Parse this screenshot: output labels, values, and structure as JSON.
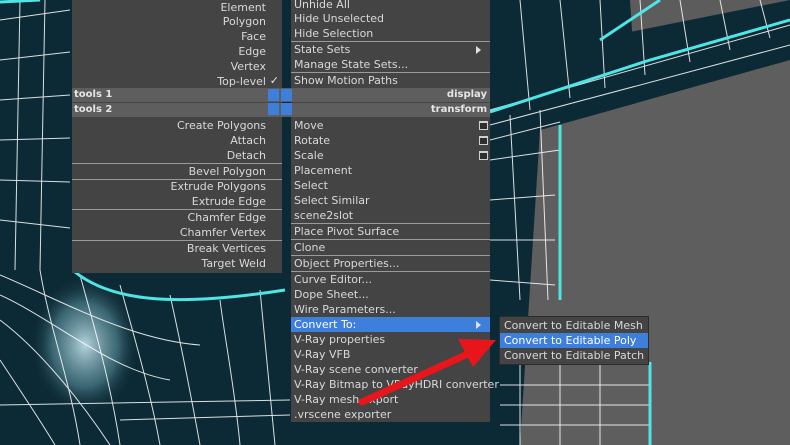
{
  "colors": {
    "menu_bg": "#444444",
    "highlight": "#3f7fdc",
    "text": "#d9d9d9",
    "wire": "#ffffff",
    "selected_edge": "#4fe5e5",
    "arrow": "#e8161b"
  },
  "quad_left": {
    "items": [
      {
        "label": "Element"
      },
      {
        "label": "Polygon"
      },
      {
        "label": "Face"
      },
      {
        "label": "Edge"
      },
      {
        "label": "Vertex"
      },
      {
        "label": "Top-level",
        "checked": true,
        "check_glyph": "✓"
      },
      {
        "label": "Create Polygons"
      },
      {
        "label": "Attach"
      },
      {
        "label": "Detach"
      },
      {
        "label": "Bevel Polygon"
      },
      {
        "label": "Extrude Polygons"
      },
      {
        "label": "Extrude Edge"
      },
      {
        "label": "Chamfer Edge"
      },
      {
        "label": "Chamfer Vertex"
      },
      {
        "label": "Break Vertices"
      },
      {
        "label": "Target Weld"
      }
    ]
  },
  "quad_headers": {
    "tools1": "tools 1",
    "tools2": "tools 2",
    "display": "display",
    "transform": "transform"
  },
  "quad_right": {
    "items": [
      {
        "label": "Unhide All"
      },
      {
        "label": "Hide Unselected"
      },
      {
        "label": "Hide Selection"
      },
      {
        "label": "State Sets",
        "submenu": true
      },
      {
        "label": "Manage State Sets..."
      },
      {
        "label": "Show Motion Paths"
      },
      {
        "label": "Move",
        "options": true
      },
      {
        "label": "Rotate",
        "options": true
      },
      {
        "label": "Scale",
        "options": true
      },
      {
        "label": "Placement"
      },
      {
        "label": "Select"
      },
      {
        "label": "Select Similar"
      },
      {
        "label": "scene2slot"
      },
      {
        "label": "Place Pivot Surface"
      },
      {
        "label": "Clone"
      },
      {
        "label": "Object Properties..."
      },
      {
        "label": "Curve Editor..."
      },
      {
        "label": "Dope Sheet..."
      },
      {
        "label": "Wire Parameters..."
      },
      {
        "label": "Convert To:",
        "submenu": true,
        "highlighted": true
      },
      {
        "label": "V-Ray properties"
      },
      {
        "label": "V-Ray VFB"
      },
      {
        "label": "V-Ray scene converter"
      },
      {
        "label": "V-Ray Bitmap to VRayHDRI converter"
      },
      {
        "label": "V-Ray mesh export"
      },
      {
        "label": ".vrscene exporter"
      }
    ]
  },
  "convert_submenu": {
    "items": [
      {
        "label": "Convert to Editable Mesh"
      },
      {
        "label": "Convert to Editable Poly",
        "highlighted": true
      },
      {
        "label": "Convert to Editable Patch"
      }
    ]
  }
}
